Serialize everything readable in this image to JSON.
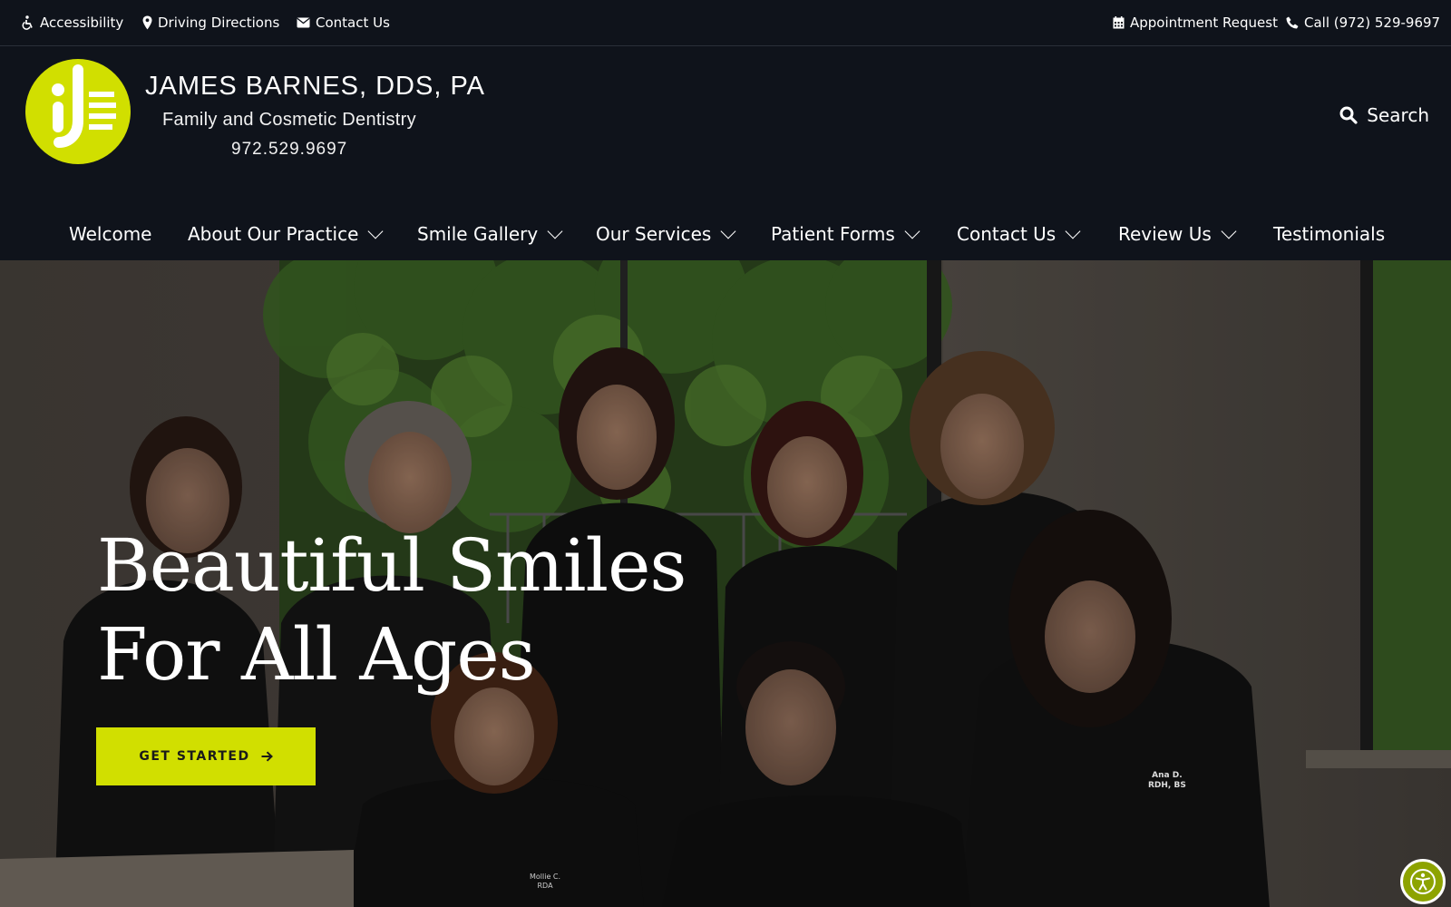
{
  "utility": {
    "accessibility": "Accessibility",
    "directions": "Driving Directions",
    "contact": "Contact Us",
    "appointment": "Appointment Request",
    "call": "Call (972) 529-9697"
  },
  "brand": {
    "name": "JAMES BARNES, DDS, PA",
    "tagline": "Family and Cosmetic Dentistry",
    "phone": "972.529.9697",
    "accent_color": "#d1df00"
  },
  "search": {
    "label": "Search"
  },
  "nav": {
    "items": [
      {
        "label": "Welcome",
        "dropdown": false
      },
      {
        "label": "About Our Practice",
        "dropdown": true
      },
      {
        "label": "Smile Gallery",
        "dropdown": true
      },
      {
        "label": "Our Services",
        "dropdown": true
      },
      {
        "label": "Patient Forms",
        "dropdown": true
      },
      {
        "label": "Contact Us",
        "dropdown": true
      },
      {
        "label": "Review Us",
        "dropdown": true
      },
      {
        "label": "Testimonials",
        "dropdown": false
      }
    ]
  },
  "hero": {
    "title_line1": "Beautiful Smiles",
    "title_line2": "For All Ages",
    "cta_label": "GET STARTED",
    "name_tags": [
      "Ana D.",
      "RDH, BS",
      "Mollie C.",
      "RDA"
    ]
  },
  "icons": {
    "accessibility": "wheelchair-icon",
    "directions": "map-marker-icon",
    "contact": "envelope-icon",
    "appointment": "calendar-icon",
    "call": "phone-icon",
    "search": "search-icon",
    "cta": "arrow-right-icon",
    "widget": "accessibility-widget-icon"
  }
}
